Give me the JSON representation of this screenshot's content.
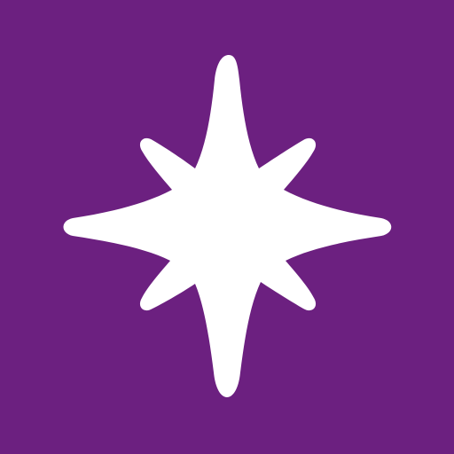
{
  "icon": {
    "name": "star-icon",
    "background_color": "#6C2080",
    "star_color": "#FFFFFF"
  }
}
